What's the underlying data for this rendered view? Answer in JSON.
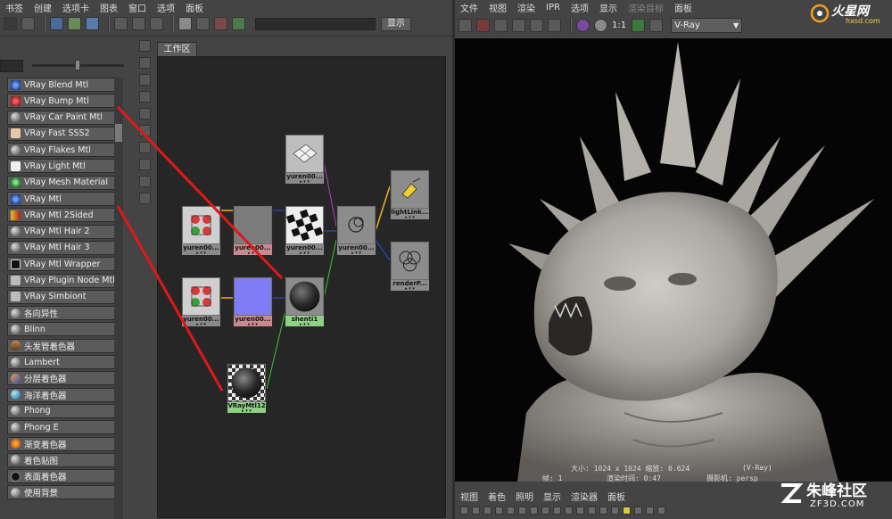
{
  "hypershade": {
    "menu": [
      "书签",
      "创建",
      "选项卡",
      "图表",
      "窗口",
      "选项",
      "面板"
    ],
    "show_button": "显示",
    "workspace_tab": "工作区",
    "library": [
      {
        "label": "VRay Blend Mtl",
        "icon": "blue"
      },
      {
        "label": "VRay Bump Mtl",
        "icon": "red"
      },
      {
        "label": "VRay Car Paint Mtl",
        "icon": "sphere"
      },
      {
        "label": "VRay Fast SSS2",
        "icon": "skin"
      },
      {
        "label": "VRay Flakes Mtl",
        "icon": "sphere"
      },
      {
        "label": "VRay Light Mtl",
        "icon": "face"
      },
      {
        "label": "VRay Mesh Material",
        "icon": "green"
      },
      {
        "label": "VRay Mtl",
        "icon": "blue"
      },
      {
        "label": "VRay Mtl 2Sided",
        "icon": "yellow"
      },
      {
        "label": "VRay Mtl Hair 2",
        "icon": "sphere"
      },
      {
        "label": "VRay Mtl Hair 3",
        "icon": "sphere"
      },
      {
        "label": "VRay Mtl Wrapper",
        "icon": "wrap"
      },
      {
        "label": "VRay Plugin Node Mtl",
        "icon": "plug"
      },
      {
        "label": "VRay Simbiont",
        "icon": "plug"
      },
      {
        "label": "各向异性",
        "icon": "sphere"
      },
      {
        "label": "Blinn",
        "icon": "sphere"
      },
      {
        "label": "头发管着色器",
        "icon": "hair"
      },
      {
        "label": "Lambert",
        "icon": "sphere"
      },
      {
        "label": "分层着色器",
        "icon": "layer"
      },
      {
        "label": "海洋着色器",
        "icon": "ocean"
      },
      {
        "label": "Phong",
        "icon": "sphere"
      },
      {
        "label": "Phong E",
        "icon": "sphere"
      },
      {
        "label": "渐变着色器",
        "icon": "ramp"
      },
      {
        "label": "着色贴图",
        "icon": "sphere"
      },
      {
        "label": "表面着色器",
        "icon": "black"
      },
      {
        "label": "使用背景",
        "icon": "sphere"
      }
    ],
    "nodes": {
      "n1": "yuren00...",
      "n2": "yuren00...",
      "n3": "yuren00...",
      "n4": "yuren00...",
      "n5": "yuren00...",
      "n6": "yuren00...",
      "n7": "yuren00...",
      "shenti": "shenti1",
      "vraymtl": "VRayMtl12",
      "lightlink": "lightLink...",
      "renderp": "renderP..."
    }
  },
  "render_view": {
    "menu": [
      "文件",
      "视图",
      "渲染",
      "IPR",
      "选项",
      "显示",
      "渲染目标",
      "面板"
    ],
    "ratio": "1:1",
    "renderer_select": "V-Ray",
    "info": {
      "size": "大小: 1024 x 1024  缩放: 0.624",
      "renderer": "(V-Ray)",
      "frame": "帧: 1",
      "time": "渲染时间: 0:47",
      "camera": "摄影机: persp"
    },
    "bottom_menu": [
      "视图",
      "着色",
      "照明",
      "显示",
      "渲染器",
      "面板"
    ]
  },
  "watermarks": {
    "top_title": "火星网",
    "top_url": "hxsd.com",
    "bottom_title": "朱峰社区",
    "bottom_url": "ZF3D.COM"
  },
  "colors": {
    "annotation_red": "#e01818",
    "connection_yellow": "#f2b01e",
    "connection_green": "#3cc23c",
    "connection_purple": "#b040c0",
    "connection_blue": "#3050e0"
  }
}
